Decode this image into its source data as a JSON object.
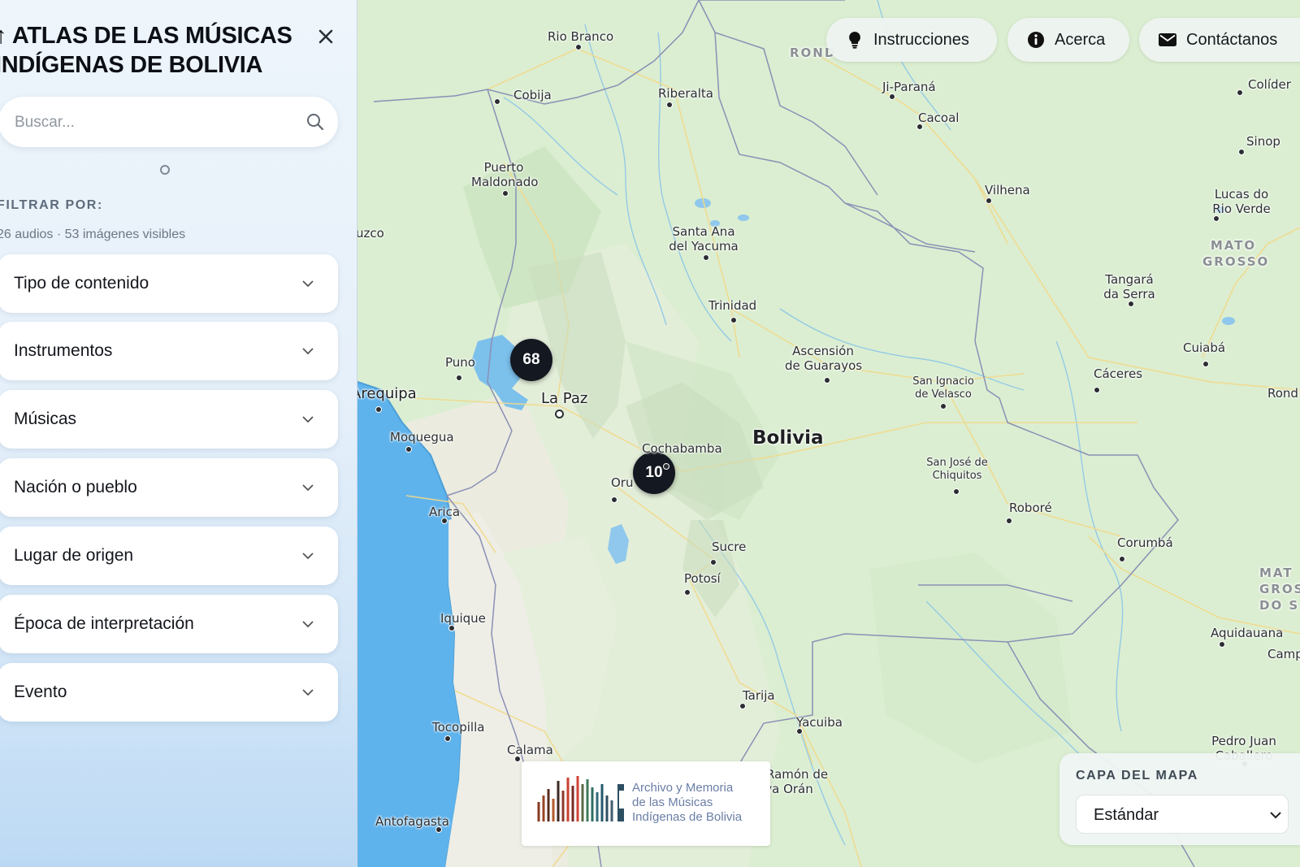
{
  "sidebar": {
    "title": "↑ ATLAS DE LAS MÚSICAS INDÍGENAS DE BOLIVIA",
    "search_placeholder": "Buscar...",
    "filter_label": "FILTRAR POR:",
    "counts": "26 audios · 53 imágenes visibles",
    "filters": [
      {
        "label": "Tipo de contenido"
      },
      {
        "label": "Instrumentos"
      },
      {
        "label": "Músicas"
      },
      {
        "label": "Nación o pueblo"
      },
      {
        "label": "Lugar de origen"
      },
      {
        "label": "Época de interpretación"
      },
      {
        "label": "Evento"
      }
    ]
  },
  "nav": {
    "instructions": "Instrucciones",
    "about": "Acerca",
    "contact": "Contáctanos"
  },
  "map": {
    "clusters": [
      "68",
      "10"
    ],
    "places": {
      "rio_branco": "Rio Branco",
      "rond": "ROND",
      "ji_parana": "Ji-Paraná",
      "colider": "Colíder",
      "cobija": "Cobija",
      "riberalta": "Riberalta",
      "cacoal": "Cacoal",
      "sinop": "Sinop",
      "puerto_maldonado_1": "Puerto",
      "puerto_maldonado_2": "Maldonado",
      "vilhena": "Vilhena",
      "lucas_1": "Lucas do",
      "lucas_2": "Rio Verde",
      "cusco": "uzco",
      "santa_ana_1": "Santa Ana",
      "santa_ana_2": "del Yacuma",
      "mato_grosso_1": "MATO",
      "mato_grosso_2": "GROSSO",
      "tangara_1": "Tangará",
      "tangara_2": "da Serra",
      "trinidad": "Trinidad",
      "ascension_1": "Ascensión",
      "ascension_2": "de Guarayos",
      "cuiaba": "Cuiabá",
      "puno": "Puno",
      "caceres": "Cáceres",
      "san_ignacio_1": "San Ignacio",
      "san_ignacio_2": "de Velasco",
      "rond2": "Rond",
      "arequipa": "Arequipa",
      "la_paz": "La Paz",
      "bolivia": "Bolivia",
      "moquegua": "Moquegua",
      "cochabamba": "Cochabamba",
      "san_jose_1": "San José de",
      "san_jose_2": "Chiquitos",
      "oruro": "Oru",
      "robore": "Roboré",
      "arica": "Arica",
      "corumba": "Corumbá",
      "sucre": "Sucre",
      "mat_1": "MAT",
      "mat_2": "GROS",
      "mat_3": "DO S",
      "potosi": "Potosí",
      "iquique": "Iquique",
      "aquidauana": "Aquidauana",
      "camp": "Camp",
      "tarija": "Tarija",
      "yacuiba": "Yacuiba",
      "tocopilla": "Tocopilla",
      "pedro_juan_1": "Pedro Juan",
      "pedro_juan_2": "Caballero",
      "calama": "Calama",
      "san_ramon_1": "San Ramón de",
      "san_ramon_2": "eva Orán",
      "antofagasta": "Antofagasta"
    }
  },
  "logo": {
    "line1": "Archivo y Memoria",
    "line2": "de las Músicas",
    "line3": "Indígenas de Bolivia"
  },
  "map_layer": {
    "title": "CAPA DEL MAPA",
    "value": "Estándar"
  },
  "colors": {
    "land": "#dcefd2",
    "water": "#5fb3ec",
    "cluster": "#141821",
    "sidebar_bottom": "#bcd9f4"
  }
}
